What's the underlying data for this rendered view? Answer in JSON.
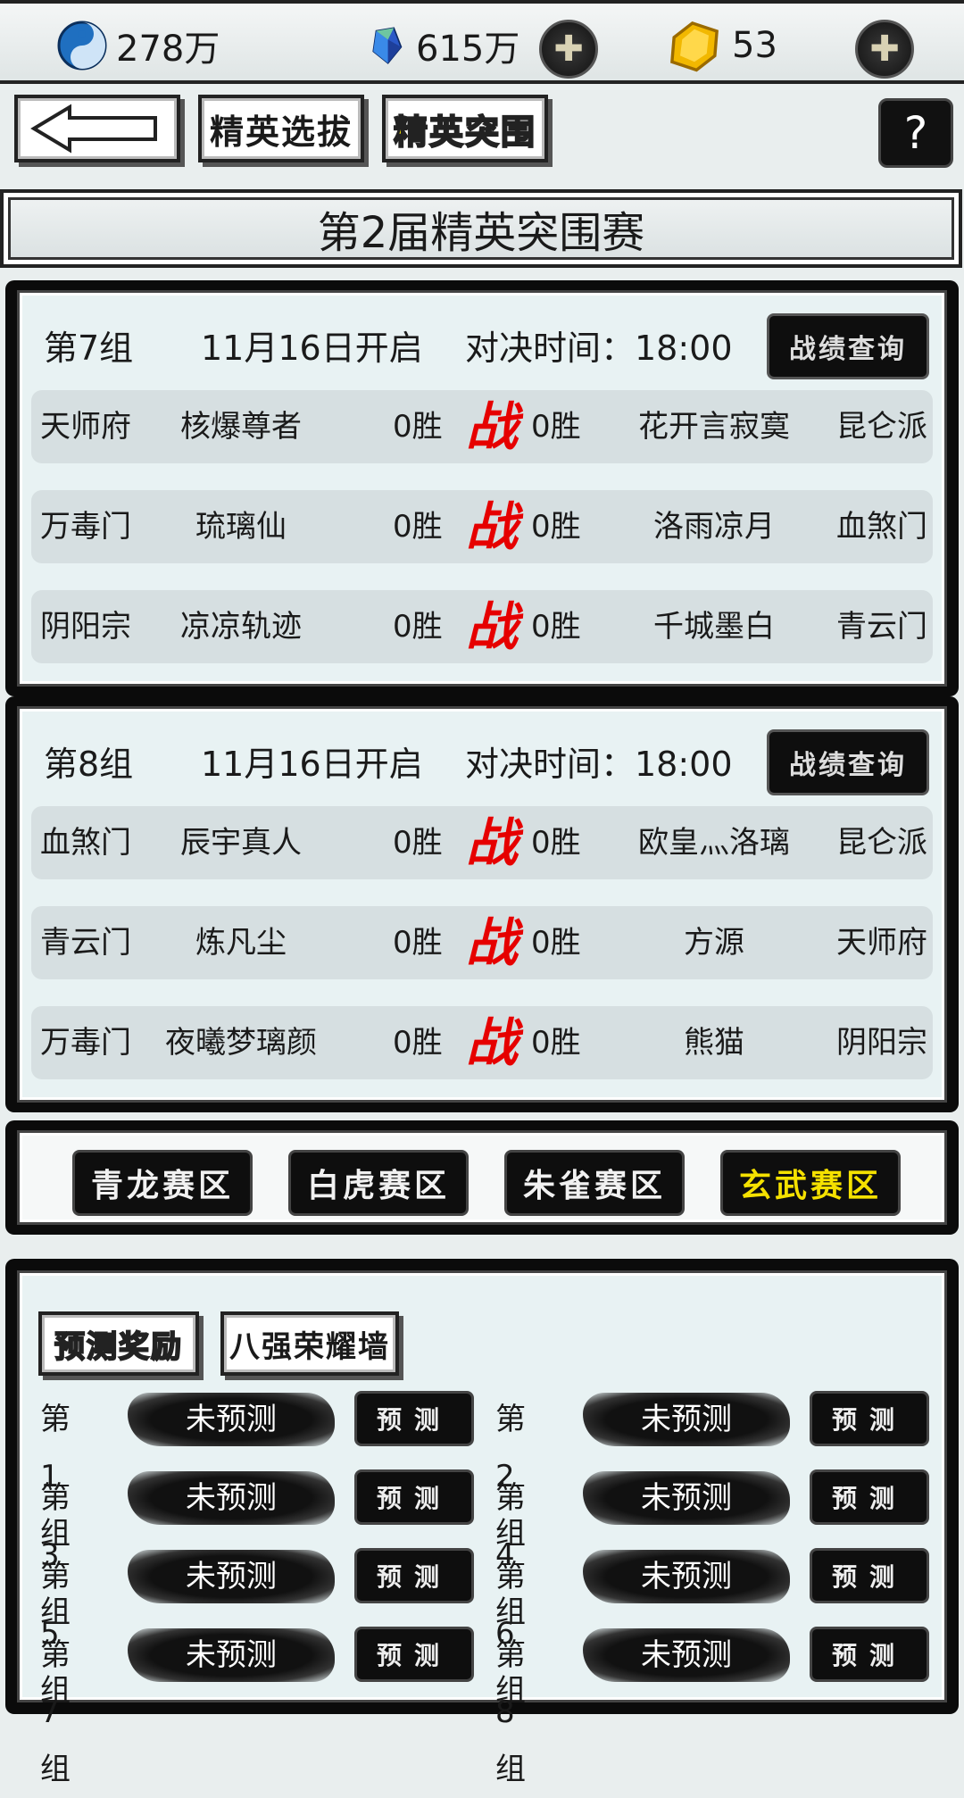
{
  "resources": {
    "taiji": "278万",
    "crystal": "615万",
    "gold": "53"
  },
  "nav": {
    "back_label": "",
    "elite_select": "精英选拔",
    "elite_breakout": "精英突围",
    "help": "?"
  },
  "banner": {
    "title": "第2届精英突围赛"
  },
  "groups": [
    {
      "name": "第7组",
      "date": "11月16日开启",
      "time": "对决时间：18:00",
      "query": "战绩查询",
      "matches": [
        {
          "sect_l": "天师府",
          "name_l": "核爆尊者",
          "win_l": "0胜",
          "vs": "战",
          "win_r": "0胜",
          "name_r": "花开言寂寞",
          "sect_r": "昆仑派"
        },
        {
          "sect_l": "万毒门",
          "name_l": "琉璃仙",
          "win_l": "0胜",
          "vs": "战",
          "win_r": "0胜",
          "name_r": "洛雨凉月",
          "sect_r": "血煞门"
        },
        {
          "sect_l": "阴阳宗",
          "name_l": "凉凉轨迹",
          "win_l": "0胜",
          "vs": "战",
          "win_r": "0胜",
          "name_r": "千城墨白",
          "sect_r": "青云门"
        }
      ]
    },
    {
      "name": "第8组",
      "date": "11月16日开启",
      "time": "对决时间：18:00",
      "query": "战绩查询",
      "matches": [
        {
          "sect_l": "血煞门",
          "name_l": "辰宇真人",
          "win_l": "0胜",
          "vs": "战",
          "win_r": "0胜",
          "name_r": "欧皇灬洛璃",
          "sect_r": "昆仑派"
        },
        {
          "sect_l": "青云门",
          "name_l": "炼凡尘",
          "win_l": "0胜",
          "vs": "战",
          "win_r": "0胜",
          "name_r": "方源",
          "sect_r": "天师府"
        },
        {
          "sect_l": "万毒门",
          "name_l": "夜曦梦璃颜",
          "win_l": "0胜",
          "vs": "战",
          "win_r": "0胜",
          "name_r": "熊猫",
          "sect_r": "阴阳宗"
        }
      ]
    }
  ],
  "zones": [
    "青龙赛区",
    "白虎赛区",
    "朱雀赛区",
    "玄武赛区"
  ],
  "prediction": {
    "tabs": [
      "预测奖励",
      "八强荣耀墙"
    ],
    "button": "预测",
    "items": [
      {
        "group": "第1组",
        "status": "未预测"
      },
      {
        "group": "第2组",
        "status": "未预测"
      },
      {
        "group": "第3组",
        "status": "未预测"
      },
      {
        "group": "第4组",
        "status": "未预测"
      },
      {
        "group": "第5组",
        "status": "未预测"
      },
      {
        "group": "第6组",
        "status": "未预测"
      },
      {
        "group": "第7组",
        "status": "未预测"
      },
      {
        "group": "第8组",
        "status": "未预测"
      }
    ]
  },
  "colors": {
    "accent_yellow": "#f4e100",
    "vs_red": "#e60000",
    "panel_dark": "#0b0b0b",
    "row_bg": "#d6dfe1"
  }
}
